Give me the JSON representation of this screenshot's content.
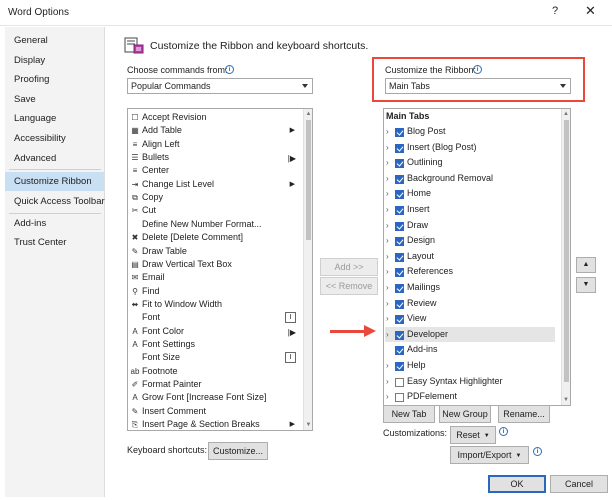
{
  "window": {
    "title": "Word Options",
    "help_label": "?",
    "close_label": "✕"
  },
  "sidebar": {
    "items": [
      {
        "label": "General"
      },
      {
        "label": "Display"
      },
      {
        "label": "Proofing"
      },
      {
        "label": "Save"
      },
      {
        "label": "Language"
      },
      {
        "label": "Accessibility"
      },
      {
        "label": "Advanced"
      },
      {
        "label": "Customize Ribbon",
        "selected": true
      },
      {
        "label": "Quick Access Toolbar"
      },
      {
        "label": "Add-ins"
      },
      {
        "label": "Trust Center"
      }
    ]
  },
  "main": {
    "heading": "Customize the Ribbon and keyboard shortcuts.",
    "choose_label": "Choose commands from:",
    "choose_value": "Popular Commands",
    "customize_label": "Customize the Ribbon:",
    "customize_value": "Main Tabs",
    "commands": [
      {
        "label": "Accept Revision",
        "icon": "accept-icon"
      },
      {
        "label": "Add Table",
        "icon": "table-icon",
        "sub": "▶"
      },
      {
        "label": "Align Left",
        "icon": "align-left-icon"
      },
      {
        "label": "Bullets",
        "icon": "bullets-icon",
        "sub": "|▶"
      },
      {
        "label": "Center",
        "icon": "center-icon"
      },
      {
        "label": "Change List Level",
        "icon": "list-level-icon",
        "sub": "▶"
      },
      {
        "label": "Copy",
        "icon": "copy-icon"
      },
      {
        "label": "Cut",
        "icon": "cut-icon"
      },
      {
        "label": "Define New Number Format...",
        "icon": ""
      },
      {
        "label": "Delete [Delete Comment]",
        "icon": "delete-comment-icon"
      },
      {
        "label": "Draw Table",
        "icon": "draw-table-icon"
      },
      {
        "label": "Draw Vertical Text Box",
        "icon": "vertical-textbox-icon"
      },
      {
        "label": "Email",
        "icon": "email-icon"
      },
      {
        "label": "Find",
        "icon": "find-icon"
      },
      {
        "label": "Fit to Window Width",
        "icon": "fit-width-icon"
      },
      {
        "label": "Font",
        "icon": "",
        "sub": "I"
      },
      {
        "label": "Font Color",
        "icon": "font-color-icon",
        "sub": "|▶"
      },
      {
        "label": "Font Settings",
        "icon": "font-settings-icon"
      },
      {
        "label": "Font Size",
        "icon": "",
        "sub": "I"
      },
      {
        "label": "Footnote",
        "icon": "footnote-icon"
      },
      {
        "label": "Format Painter",
        "icon": "format-painter-icon"
      },
      {
        "label": "Grow Font [Increase Font Size]",
        "icon": "grow-font-icon"
      },
      {
        "label": "Insert Comment",
        "icon": "insert-comment-icon"
      },
      {
        "label": "Insert Page & Section Breaks",
        "icon": "page-break-icon",
        "sub": "▶"
      }
    ],
    "add_label": "Add >>",
    "remove_label": "<< Remove",
    "tabs_header": "Main Tabs",
    "tabs": [
      {
        "label": "Blog Post",
        "checked": true
      },
      {
        "label": "Insert (Blog Post)",
        "checked": true
      },
      {
        "label": "Outlining",
        "checked": true
      },
      {
        "label": "Background Removal",
        "checked": true
      },
      {
        "label": "Home",
        "checked": true
      },
      {
        "label": "Insert",
        "checked": true
      },
      {
        "label": "Draw",
        "checked": true
      },
      {
        "label": "Design",
        "checked": true
      },
      {
        "label": "Layout",
        "checked": true
      },
      {
        "label": "References",
        "checked": true
      },
      {
        "label": "Mailings",
        "checked": true
      },
      {
        "label": "Review",
        "checked": true
      },
      {
        "label": "View",
        "checked": true
      },
      {
        "label": "Developer",
        "checked": true,
        "highlighted": true
      },
      {
        "label": "Add-ins",
        "checked": true,
        "no_expander": true
      },
      {
        "label": "Help",
        "checked": true
      },
      {
        "label": "Easy Syntax Highlighter",
        "checked": false
      },
      {
        "label": "PDFelement",
        "checked": false
      }
    ],
    "new_tab_label": "New Tab",
    "new_group_label": "New Group",
    "rename_label": "Rename...",
    "customizations_label": "Customizations:",
    "reset_label": "Reset",
    "import_export_label": "Import/Export",
    "keyboard_label": "Keyboard shortcuts:",
    "customize_button_label": "Customize...",
    "ok_label": "OK",
    "cancel_label": "Cancel",
    "accent_color": "#e8493a",
    "selection_color": "#2a67c0"
  }
}
